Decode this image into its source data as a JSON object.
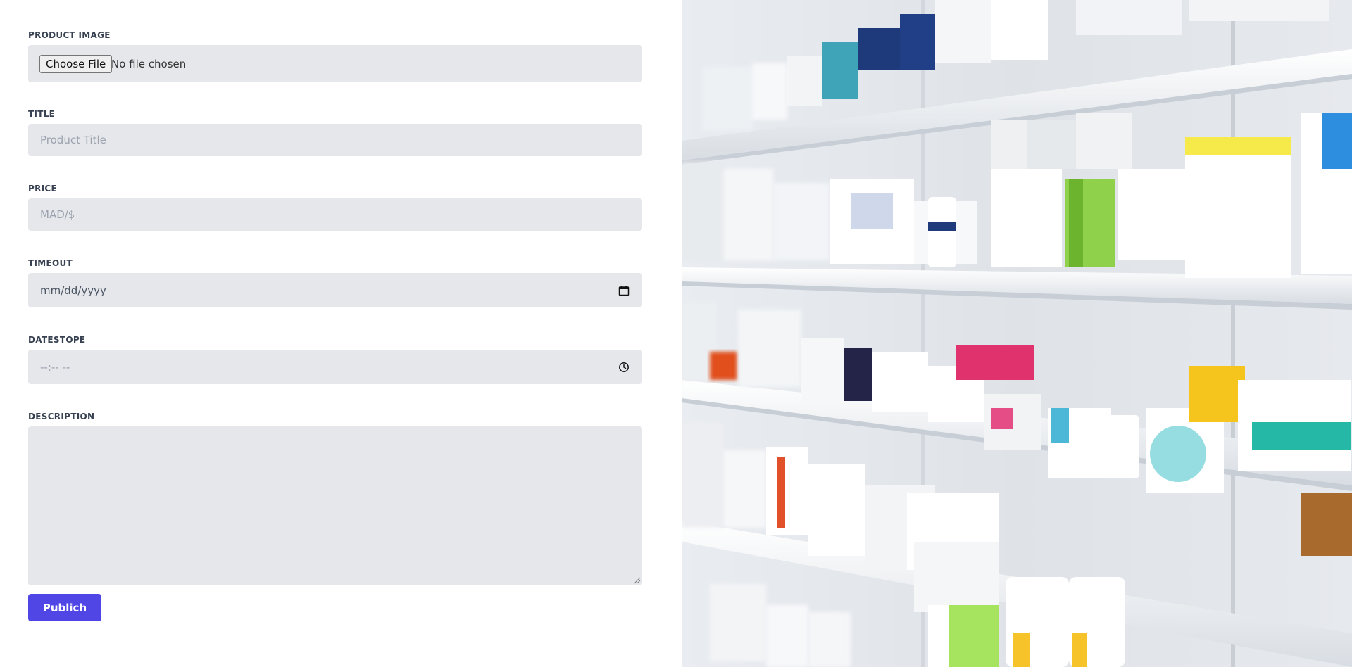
{
  "form": {
    "product_image": {
      "label": "PRODUCT IMAGE",
      "button_label": "Choose File",
      "status_text": "No file chosen"
    },
    "title": {
      "label": "TITLE",
      "placeholder": "Product Title"
    },
    "price": {
      "label": "PRICE",
      "placeholder": "MAD/$"
    },
    "timeout": {
      "label": "TIMEOUT",
      "value_text": "mm/dd/yyyy",
      "icon": "calendar-icon"
    },
    "datestope": {
      "label": "DATESTOPE",
      "value_text": "--:-- --",
      "icon": "clock-icon"
    },
    "description": {
      "label": "DESCRIPTION",
      "value": ""
    },
    "submit_label": "Publich"
  },
  "colors": {
    "input_bg": "#e5e7eb",
    "button_primary": "#4f46e5",
    "label_text": "#374151"
  },
  "hero_image": {
    "subject": "pharmacy shelves with medicine boxes"
  }
}
